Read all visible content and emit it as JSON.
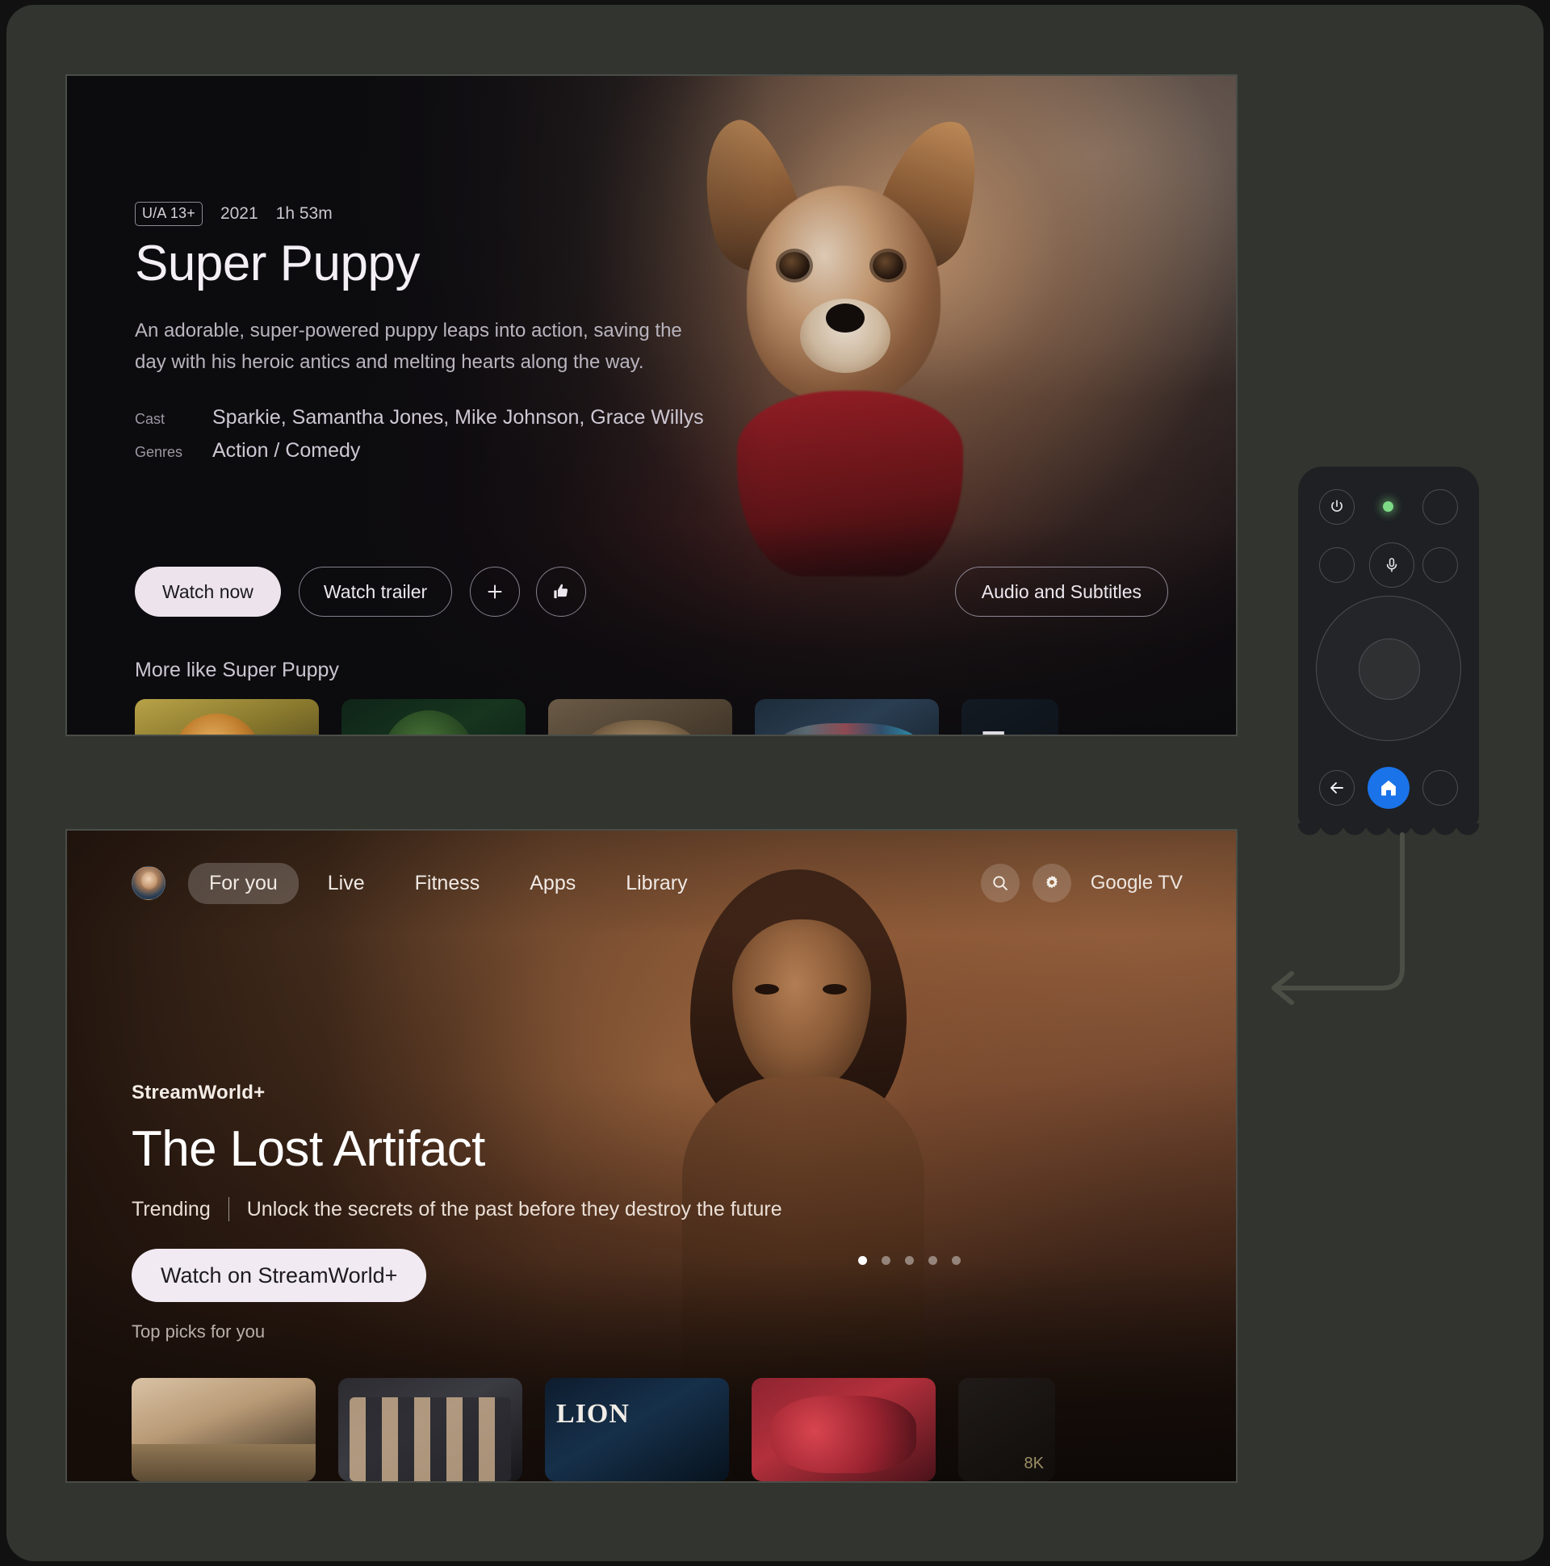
{
  "detail_screen": {
    "rating": "U/A 13+",
    "year": "2021",
    "duration": "1h 53m",
    "title": "Super Puppy",
    "description": "An adorable, super-powered puppy leaps into action, saving the day with his heroic antics and melting hearts along the way.",
    "cast_label": "Cast",
    "cast_value": "Sparkie, Samantha Jones, Mike Johnson, Grace Willys",
    "genres_label": "Genres",
    "genres_value": "Action / Comedy",
    "actions": {
      "watch_now": "Watch now",
      "watch_trailer": "Watch trailer",
      "add_to_watchlist_icon": "plus-icon",
      "like_icon": "thumbs-up-icon",
      "audio_and_subtitles": "Audio and Subtitles"
    },
    "more_like_heading": "More like Super Puppy",
    "related_tiles": [
      {
        "name": "tiger-cub"
      },
      {
        "name": "hedgehog"
      },
      {
        "name": "monkeys"
      },
      {
        "name": "birds"
      },
      {
        "name": "partial-tile",
        "glyph": "F"
      }
    ]
  },
  "home_screen": {
    "avatar_name": "profile-avatar",
    "tabs": [
      {
        "label": "For you",
        "active": true
      },
      {
        "label": "Live",
        "active": false
      },
      {
        "label": "Fitness",
        "active": false
      },
      {
        "label": "Apps",
        "active": false
      },
      {
        "label": "Library",
        "active": false
      }
    ],
    "search_icon": "search-icon",
    "settings_icon": "gear-icon",
    "brand": "Google TV",
    "hero": {
      "provider": "StreamWorld+",
      "title": "The Lost Artifact",
      "badge": "Trending",
      "tagline": "Unlock the secrets of the past before they destroy the future",
      "cta": "Watch on StreamWorld+"
    },
    "carousel": {
      "total": 5,
      "active_index": 0
    },
    "picks_heading": "Top picks for you",
    "pick_tiles": [
      {
        "name": "desert-landscape"
      },
      {
        "name": "ensemble-cast"
      },
      {
        "name": "lion",
        "glyph": "LION"
      },
      {
        "name": "soccer-celebration"
      },
      {
        "name": "partial-tile",
        "glyph": "8K"
      }
    ]
  },
  "remote": {
    "power_icon": "power-icon",
    "led_indicator": "status-led",
    "assistant_icon": "microphone-icon",
    "dpad": "dpad-control",
    "back_icon": "back-arrow-icon",
    "home_icon": "home-icon"
  },
  "annotation": {
    "arrow": "callout-arrow"
  },
  "colors": {
    "accent_blue": "#1a73e8",
    "led_green": "#7ddb86",
    "panel_bg": "#32352f"
  }
}
